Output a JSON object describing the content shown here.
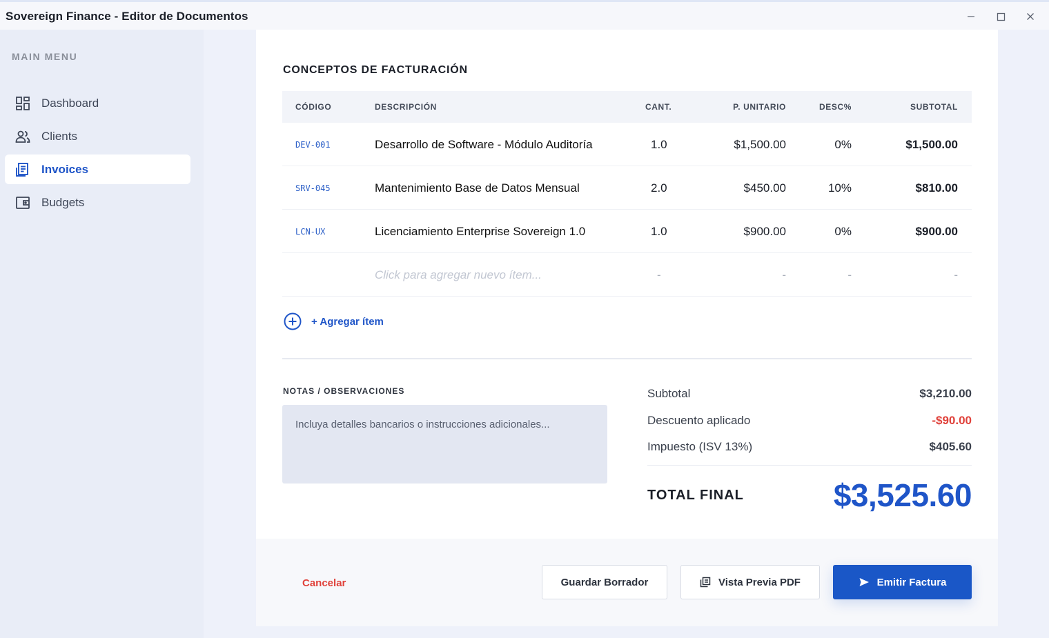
{
  "window": {
    "title": "Sovereign Finance - Editor de Documentos"
  },
  "sidebar": {
    "menu_title": "MAIN MENU",
    "items": [
      {
        "label": "Dashboard",
        "icon": "dashboard-icon"
      },
      {
        "label": "Clients",
        "icon": "clients-icon"
      },
      {
        "label": "Invoices",
        "icon": "invoice-icon",
        "active": true
      },
      {
        "label": "Budgets",
        "icon": "wallet-icon"
      }
    ]
  },
  "items_section": {
    "title": "CONCEPTOS DE FACTURACIÓN",
    "columns": [
      "CÓDIGO",
      "DESCRIPCIÓN",
      "CANT.",
      "P. UNITARIO",
      "DESC%",
      "SUBTOTAL"
    ],
    "rows": [
      {
        "code": "DEV-001",
        "description": "Desarrollo de Software - Módulo Auditoría",
        "qty": "1.0",
        "unit_price": "$1,500.00",
        "discount": "0%",
        "subtotal": "$1,500.00"
      },
      {
        "code": "SRV-045",
        "description": "Mantenimiento Base de Datos Mensual",
        "qty": "2.0",
        "unit_price": "$450.00",
        "discount": "10%",
        "subtotal": "$810.00"
      },
      {
        "code": "LCN-UX",
        "description": "Licenciamiento Enterprise Sovereign 1.0",
        "qty": "1.0",
        "unit_price": "$900.00",
        "discount": "0%",
        "subtotal": "$900.00"
      }
    ],
    "new_row": {
      "placeholder": "Click para agregar nuevo ítem...",
      "qty": "-",
      "unit_price": "-",
      "discount": "-",
      "subtotal": "-"
    },
    "add_item_label": "+ Agregar ítem"
  },
  "notes": {
    "title": "NOTAS / OBSERVACIONES",
    "value": "",
    "placeholder": "Incluya detalles bancarios o instrucciones adicionales..."
  },
  "summary": {
    "subtotal_label": "Subtotal",
    "subtotal_value": "$3,210.00",
    "discount_label": "Descuento aplicado",
    "discount_value": "-$90.00",
    "tax_label": "Impuesto (ISV 13%)",
    "tax_value": "$405.60",
    "total_label": "TOTAL FINAL",
    "total_value": "$3,525.60"
  },
  "footer": {
    "cancel_label": "Cancelar",
    "save_draft_label": "Guardar Borrador",
    "preview_label": "Vista Previa PDF",
    "issue_label": "Emitir Factura"
  },
  "colors": {
    "accent": "#1f55c8",
    "danger": "#e0413a",
    "sidebar_bg": "#e9edf7",
    "header_bg": "#f2f4f9"
  }
}
